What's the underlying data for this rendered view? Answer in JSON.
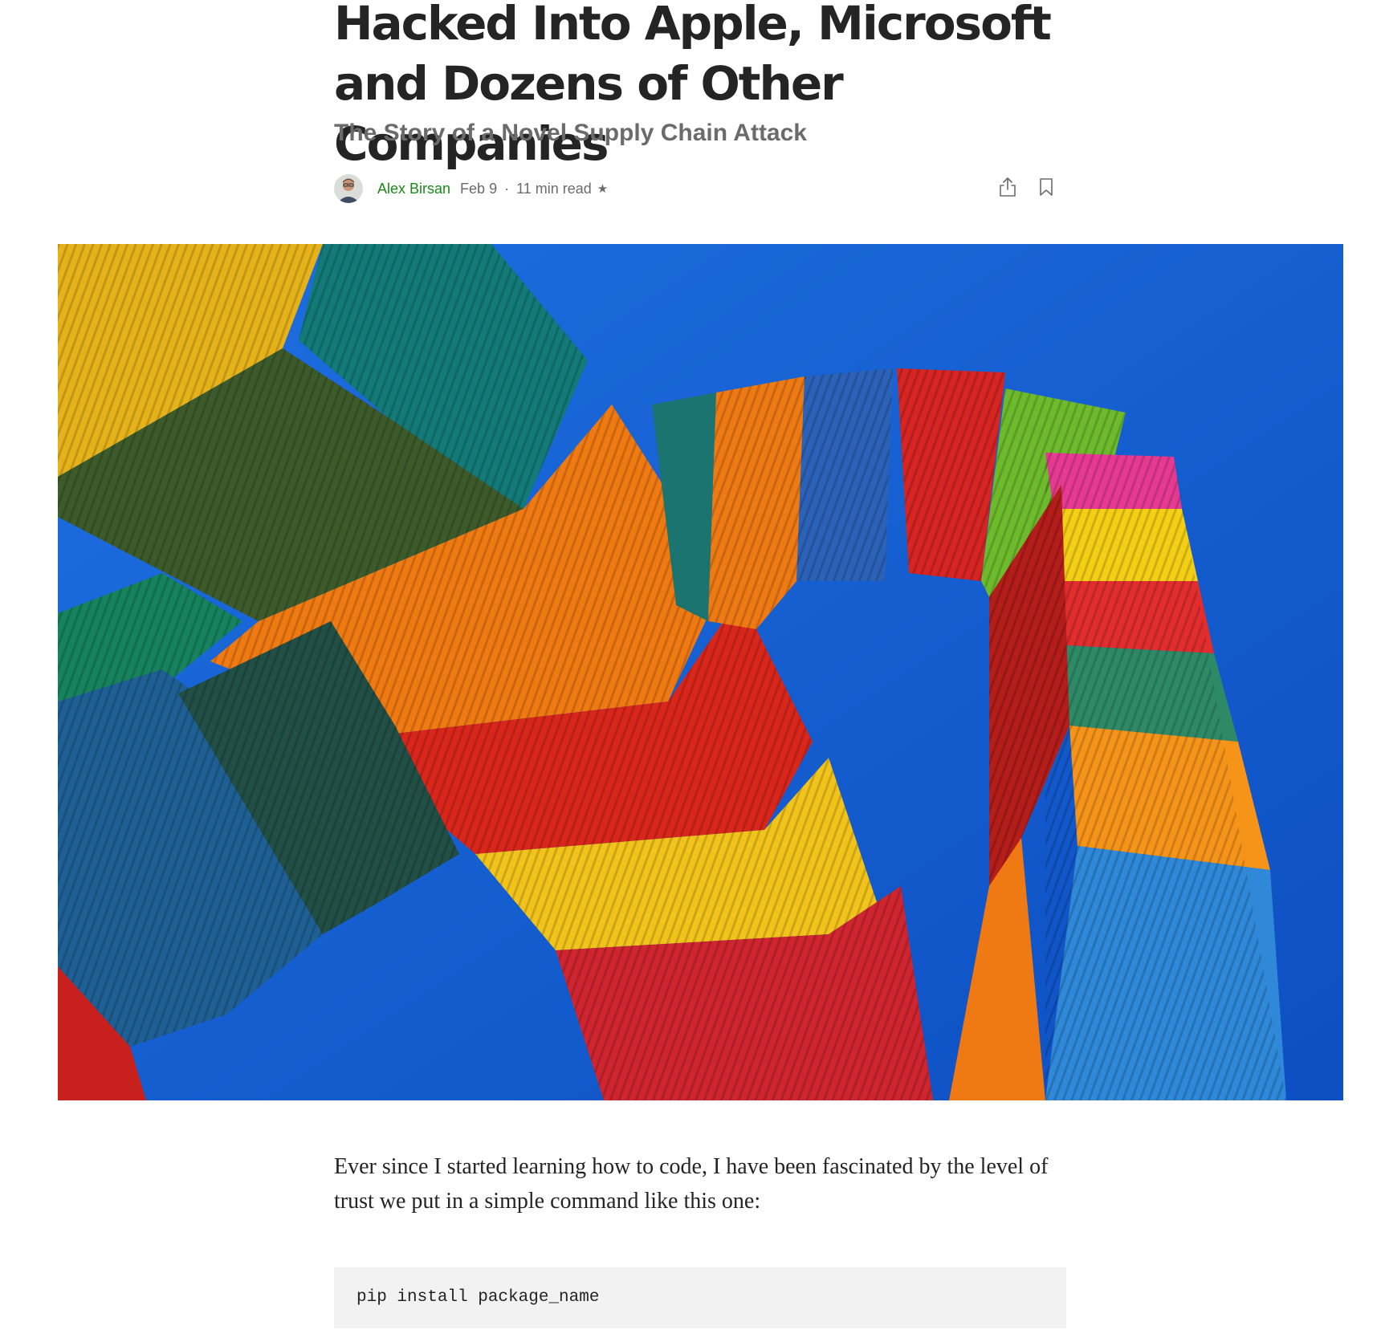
{
  "article": {
    "title_line1": "Hacked Into Apple, Microsoft",
    "title_line2": "and Dozens of Other Companies",
    "subtitle": "The Story of a Novel Supply Chain Attack",
    "author": "Alex Birsan",
    "date": "Feb 9",
    "separator": "·",
    "read_time": "11 min read",
    "member_star": "★",
    "paragraph_1": "Ever since I started learning how to code, I have been fascinated by the level of trust we put in a simple command like this one:",
    "code_block": "pip install package_name"
  },
  "icons": {
    "share": "share-icon",
    "bookmark": "bookmark-icon",
    "member": "star-icon"
  },
  "colors": {
    "author_link": "#1a8917",
    "text": "#242424",
    "muted": "#6b6b6b",
    "code_bg": "#f2f2f2",
    "sky": "#1457c8"
  }
}
